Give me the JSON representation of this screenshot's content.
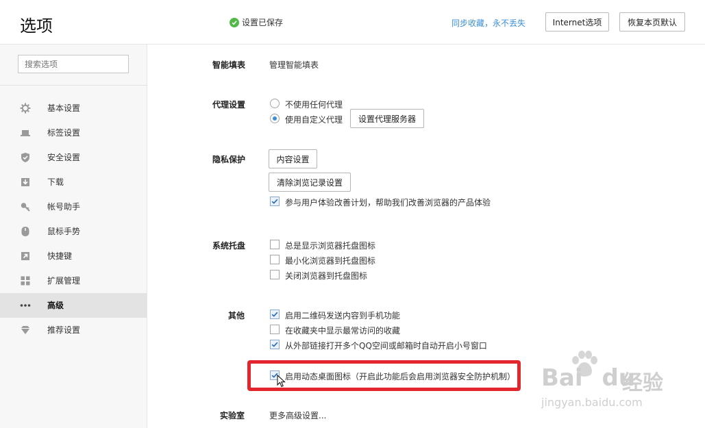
{
  "header": {
    "title": "选项",
    "saved_status": "设置已保存",
    "sync_link": "同步收藏，永不丢失",
    "internet_options_button": "Internet选项",
    "restore_defaults_button": "恢复本页默认"
  },
  "sidebar": {
    "search_placeholder": "搜索选项",
    "items": [
      {
        "label": "基本设置",
        "icon": "gear-icon"
      },
      {
        "label": "标签设置",
        "icon": "laptop-icon"
      },
      {
        "label": "安全设置",
        "icon": "shield-check-icon"
      },
      {
        "label": "下载",
        "icon": "download-icon"
      },
      {
        "label": "帐号助手",
        "icon": "key-icon"
      },
      {
        "label": "鼠标手势",
        "icon": "mouse-shield-icon"
      },
      {
        "label": "快捷键",
        "icon": "shortcut-arrow-icon"
      },
      {
        "label": "扩展管理",
        "icon": "grid-icon"
      },
      {
        "label": "高级",
        "icon": "more-dots-icon",
        "active": true
      },
      {
        "label": "推荐设置",
        "icon": "diamond-icon"
      }
    ]
  },
  "main": {
    "autofill": {
      "label": "智能填表",
      "link": "管理智能填表"
    },
    "proxy": {
      "label": "代理设置",
      "option_none": "不使用任何代理",
      "option_custom": "使用自定义代理",
      "selected": "option_custom",
      "server_button": "设置代理服务器"
    },
    "privacy": {
      "label": "隐私保护",
      "content_button": "内容设置",
      "clear_button": "清除浏览记录设置",
      "ux_plan": {
        "label": "参与用户体验改善计划，帮助我们改善浏览器的产品体验",
        "checked": true
      }
    },
    "tray": {
      "label": "系统托盘",
      "options": [
        {
          "label": "总是显示浏览器托盘图标",
          "checked": false
        },
        {
          "label": "最小化浏览器到托盘图标",
          "checked": false
        },
        {
          "label": "关闭浏览器到托盘图标",
          "checked": false
        }
      ]
    },
    "other": {
      "label": "其他",
      "options": [
        {
          "label": "启用二维码发送内容到手机功能",
          "checked": true
        },
        {
          "label": "在收藏夹中显示最常访问的收藏",
          "checked": false
        },
        {
          "label": "从外部链接打开多个QQ空间或邮箱时自动开启小号窗口",
          "checked": true
        },
        {
          "label": "启用动态桌面图标（开启此功能后会启用浏览器安全防护机制）",
          "checked": true
        }
      ]
    },
    "lab": {
      "label": "实验室",
      "link": "更多高级设置..."
    }
  },
  "watermark": {
    "brand": "Bai",
    "brand2": "du",
    "cn": "经验",
    "url": "jingyan.baidu.com"
  },
  "colors": {
    "accent": "#3c8fd6",
    "success": "#52b948",
    "highlight": "#e3262e"
  }
}
